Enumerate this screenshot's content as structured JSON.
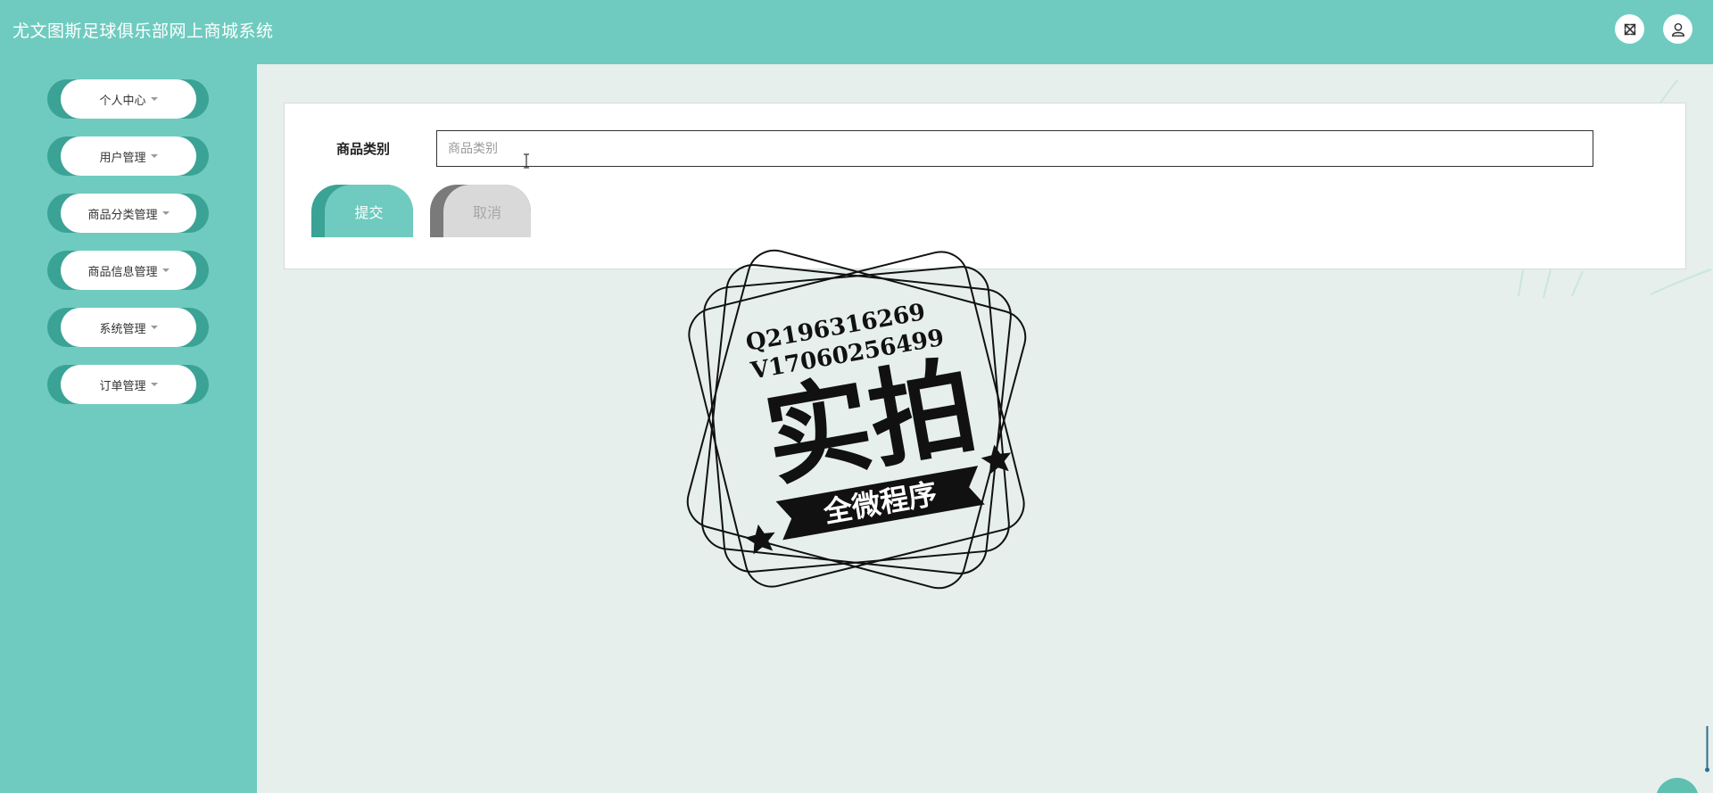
{
  "app": {
    "title": "尤文图斯足球俱乐部网上商城系统"
  },
  "header": {
    "fullscreen_icon": "fullscreen-icon",
    "user_icon": "user-icon"
  },
  "sidebar": {
    "items": [
      {
        "label": "个人中心"
      },
      {
        "label": "用户管理"
      },
      {
        "label": "商品分类管理"
      },
      {
        "label": "商品信息管理"
      },
      {
        "label": "系统管理"
      },
      {
        "label": "订单管理"
      }
    ]
  },
  "form": {
    "category_label": "商品类别",
    "category_placeholder": "商品类别",
    "category_value": ""
  },
  "actions": {
    "submit_label": "提交",
    "cancel_label": "取消"
  },
  "watermark": {
    "line1": "Q2196316269",
    "line2": "V17060256499",
    "main": "实拍",
    "banner": "全微程序"
  },
  "colors": {
    "primary": "#6fcbbf",
    "primary_dark": "#3aa395",
    "background": "#e6efeb",
    "cancel_bg": "#d9d9d9"
  }
}
